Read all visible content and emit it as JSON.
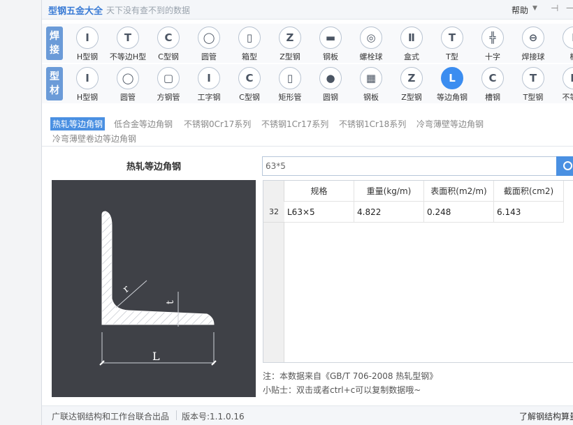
{
  "app": {
    "title": "型钢五金大全",
    "subtitle": "天下没有查不到的数据",
    "help": "帮助",
    "help_arrow": "▼",
    "pin": "⊣",
    "minimize": "—"
  },
  "weld_row": {
    "tag": "焊接",
    "items": [
      {
        "label": "H型钢",
        "glyph": "I"
      },
      {
        "label": "不等边H型",
        "glyph": "T"
      },
      {
        "label": "C型钢",
        "glyph": "C"
      },
      {
        "label": "圆管",
        "glyph": "◯"
      },
      {
        "label": "箱型",
        "glyph": "▯"
      },
      {
        "label": "Z型钢",
        "glyph": "Z"
      },
      {
        "label": "钢板",
        "glyph": "▬"
      },
      {
        "label": "螺栓球",
        "glyph": "◎"
      },
      {
        "label": "盒式",
        "glyph": "Ⅱ"
      },
      {
        "label": "T型",
        "glyph": "T"
      },
      {
        "label": "十字",
        "glyph": "╬"
      },
      {
        "label": "焊接球",
        "glyph": "⊖"
      },
      {
        "label": "椭",
        "glyph": "I"
      }
    ]
  },
  "profile_row": {
    "tag": "型材",
    "items": [
      {
        "label": "H型钢",
        "glyph": "I"
      },
      {
        "label": "圆管",
        "glyph": "◯"
      },
      {
        "label": "方钢管",
        "glyph": "▢"
      },
      {
        "label": "工字钢",
        "glyph": "I"
      },
      {
        "label": "C型钢",
        "glyph": "C"
      },
      {
        "label": "矩形管",
        "glyph": "▯"
      },
      {
        "label": "圆钢",
        "glyph": "●"
      },
      {
        "label": "钢板",
        "glyph": "▦"
      },
      {
        "label": "Z型钢",
        "glyph": "Z"
      },
      {
        "label": "等边角钢",
        "glyph": "L",
        "active": true
      },
      {
        "label": "槽钢",
        "glyph": "C"
      },
      {
        "label": "T型钢",
        "glyph": "T"
      },
      {
        "label": "不等边",
        "glyph": "L"
      }
    ]
  },
  "subtabs": [
    "热轧等边角钢",
    "低合金等边角钢",
    "不锈钢0Cr17系列",
    "不锈钢1Cr17系列",
    "不锈钢1Cr18系列",
    "冷弯薄壁等边角钢",
    "冷弯薄壁卷边等边角钢"
  ],
  "figure": {
    "title": "热轧等边角钢",
    "label_r": "r",
    "label_t": "t",
    "label_L": "L"
  },
  "search": {
    "value": "63*5"
  },
  "table": {
    "headers": [
      "规格",
      "重量(kg/m)",
      "表面积(m2/m)",
      "截面积(cm2)"
    ],
    "row_index": "32",
    "row": [
      "L63×5",
      "4.822",
      "0.248",
      "6.143"
    ]
  },
  "notes": {
    "source": "注：本数据来自《GB/T  706-2008  热轧型钢》",
    "tip": "小贴士：双击或者ctrl+c可以复制数据哦~"
  },
  "status": {
    "publisher": "广联达钢结构和工作台联合出品",
    "version": "版本号:1.1.0.16",
    "learn": "了解钢结构算量"
  }
}
